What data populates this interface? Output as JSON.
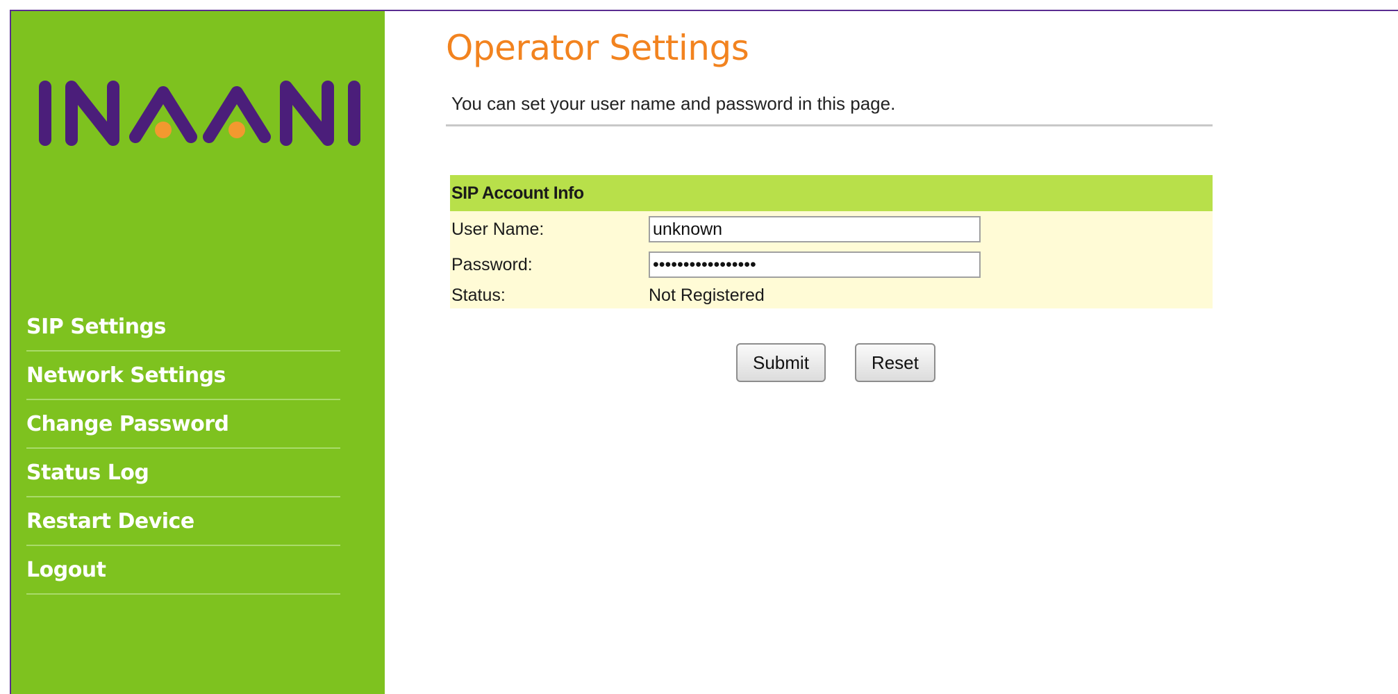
{
  "brand": {
    "name": "INAANI",
    "colors": {
      "purple": "#4b1e7a",
      "orange": "#f2992f",
      "green": "#7ec21f"
    }
  },
  "sidebar": {
    "items": [
      {
        "label": "SIP Settings"
      },
      {
        "label": "Network Settings"
      },
      {
        "label": "Change Password"
      },
      {
        "label": "Status Log"
      },
      {
        "label": "Restart Device"
      },
      {
        "label": "Logout"
      }
    ]
  },
  "main": {
    "title": "Operator Settings",
    "subtitle": "You can set your user name and password in this page.",
    "section_title": "SIP Account Info",
    "fields": {
      "username_label": "User Name:",
      "username_value": "unknown",
      "password_label": "Password:",
      "password_value": "12345678901234567",
      "status_label": "Status:",
      "status_value": "Not Registered"
    },
    "buttons": {
      "submit": "Submit",
      "reset": "Reset"
    }
  }
}
